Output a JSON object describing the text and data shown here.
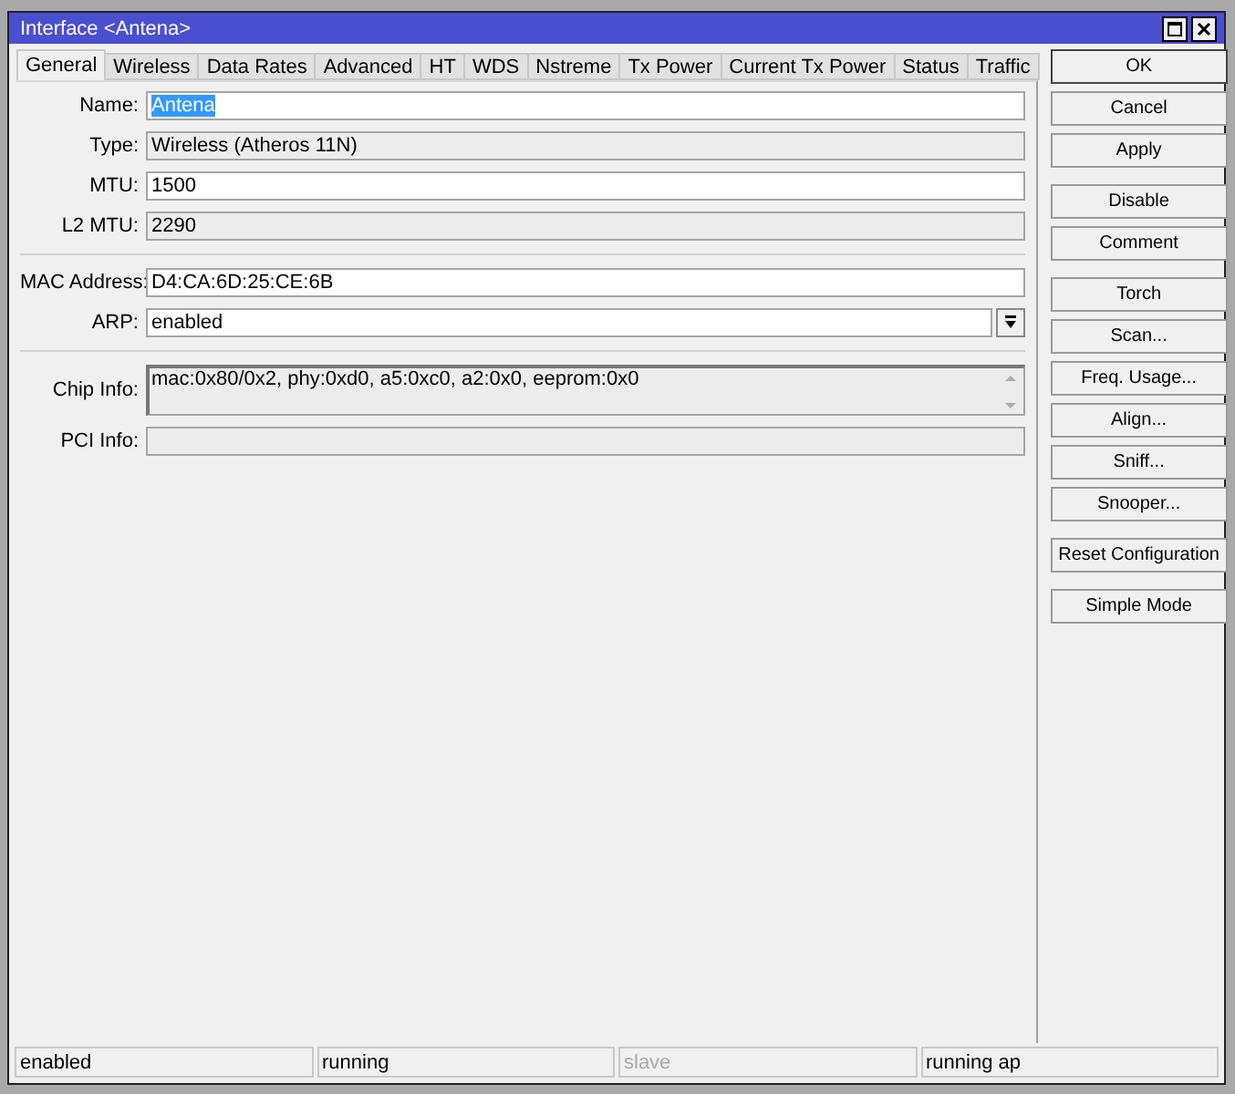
{
  "window": {
    "title": "Interface <Antena>"
  },
  "tabs": [
    {
      "label": "General",
      "selected": true
    },
    {
      "label": "Wireless",
      "selected": false
    },
    {
      "label": "Data Rates",
      "selected": false
    },
    {
      "label": "Advanced",
      "selected": false
    },
    {
      "label": "HT",
      "selected": false
    },
    {
      "label": "WDS",
      "selected": false
    },
    {
      "label": "Nstreme",
      "selected": false
    },
    {
      "label": "Tx Power",
      "selected": false
    },
    {
      "label": "Current Tx Power",
      "selected": false
    },
    {
      "label": "Status",
      "selected": false
    },
    {
      "label": "Traffic",
      "selected": false
    }
  ],
  "field_groups": [
    [
      {
        "label": "Name:",
        "kind": "text",
        "value": "Antena",
        "highlighted": true
      },
      {
        "label": "Type:",
        "kind": "readonly",
        "value": "Wireless (Atheros 11N)"
      },
      {
        "label": "MTU:",
        "kind": "text",
        "value": "1500"
      },
      {
        "label": "L2 MTU:",
        "kind": "readonly",
        "value": "2290"
      }
    ],
    [
      {
        "label": "MAC Address:",
        "kind": "text",
        "value": "D4:CA:6D:25:CE:6B"
      },
      {
        "label": "ARP:",
        "kind": "select",
        "value": "enabled"
      }
    ],
    [
      {
        "label": "Chip Info:",
        "kind": "textarea",
        "value": "mac:0x80/0x2, phy:0xd0, a5:0xc0, a2:0x0, eeprom:0x0"
      },
      {
        "label": "PCI Info:",
        "kind": "readonly"
      }
    ]
  ],
  "button_groups": [
    [
      "OK",
      "Cancel",
      "Apply"
    ],
    [
      "Disable",
      "Comment"
    ],
    [
      "Torch",
      "Scan...",
      "Freq. Usage...",
      "Align...",
      "Sniff...",
      "Snooper..."
    ],
    [
      "Reset Configuration"
    ],
    [
      "Simple Mode"
    ]
  ],
  "status_bar": [
    {
      "text": "enabled",
      "disabled": false
    },
    {
      "text": "running",
      "disabled": false
    },
    {
      "text": "slave",
      "disabled": true
    },
    {
      "text": "running ap",
      "disabled": false
    }
  ]
}
